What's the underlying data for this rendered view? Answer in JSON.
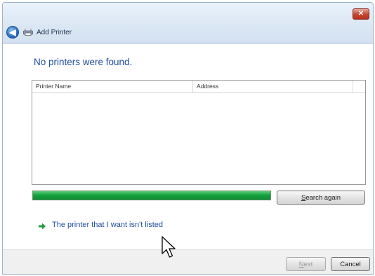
{
  "window": {
    "title": "Add Printer",
    "close_label": "✕",
    "back_glyph": "◀"
  },
  "main": {
    "heading": "No printers were found.",
    "list": {
      "columns": [
        "Printer Name",
        "Address"
      ],
      "rows": []
    },
    "progress": {
      "value": 1.0,
      "color": "#14a23f"
    },
    "search_again": {
      "accel": "S",
      "rest": "earch again"
    },
    "link": "The printer that I want isn't listed"
  },
  "footer": {
    "next": {
      "accel": "N",
      "rest": "ext",
      "enabled": false
    },
    "cancel": "Cancel"
  },
  "icons": {
    "back": "back-arrow-icon",
    "printer": "printer-icon",
    "link_arrow": "green-arrow-icon",
    "cursor": "mouse-cursor-icon",
    "close": "close-icon"
  }
}
